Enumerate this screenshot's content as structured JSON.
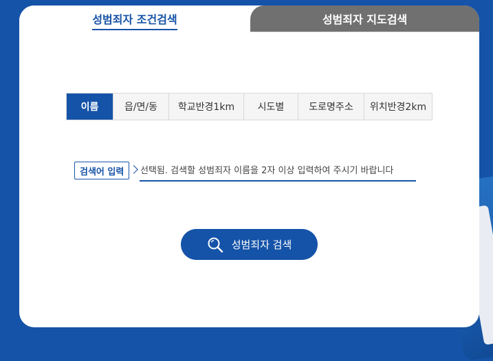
{
  "tabs": {
    "condition_search": "성범죄자 조건검색",
    "map_search": "성범죄자 지도검색"
  },
  "search_types": [
    {
      "label": "이름",
      "selected": true
    },
    {
      "label": "읍/면/동",
      "selected": false
    },
    {
      "label": "학교반경1km",
      "selected": false
    },
    {
      "label": "시도별",
      "selected": false
    },
    {
      "label": "도로명주소",
      "selected": false
    },
    {
      "label": "위치반경2km",
      "selected": false
    }
  ],
  "search": {
    "label": "검색어 입력",
    "placeholder": "선택됨. 검색할 성범죄자 이름을 2자 이상 입력하여 주시기 바랍니다",
    "value": ""
  },
  "submit": {
    "label": "성범죄자 검색",
    "icon": "search-icon"
  },
  "colors": {
    "primary": "#1553a8",
    "inactive_tab": "#707070",
    "page_background": "#1553a8"
  }
}
